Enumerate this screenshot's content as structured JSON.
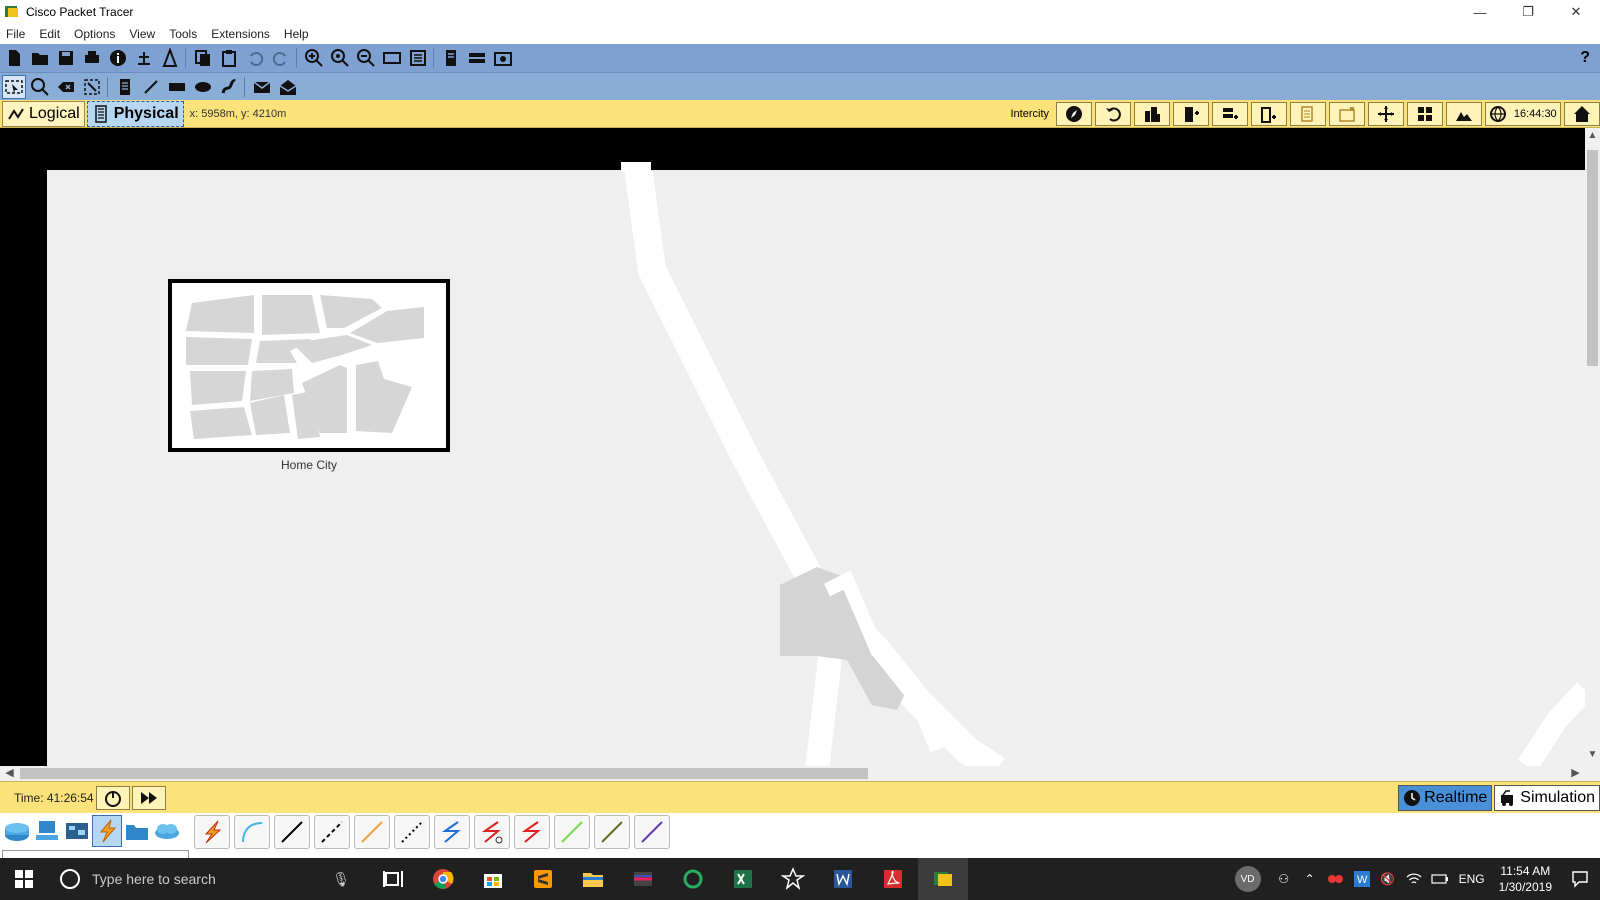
{
  "window": {
    "title": "Cisco Packet Tracer",
    "controls": {
      "minimize": "—",
      "restore": "❐",
      "close": "✕"
    }
  },
  "menu": [
    "File",
    "Edit",
    "Options",
    "View",
    "Tools",
    "Extensions",
    "Help"
  ],
  "toolbar": {
    "help": "?"
  },
  "nav": {
    "logical": "Logical",
    "physical": "Physical",
    "coords": "x: 5958m, y: 4210m",
    "location": "Intercity",
    "clock": "16:44:30"
  },
  "map": {
    "city_label": "Home City"
  },
  "timebar": {
    "time": "Time: 41:26:54",
    "realtime": "Realtime",
    "simulation": "Simulation"
  },
  "cables": [
    {
      "name": "automatic",
      "color": "#f0a020"
    },
    {
      "name": "console",
      "color": "#3fb8e0"
    },
    {
      "name": "copper-straight",
      "color": "#000000"
    },
    {
      "name": "copper-cross",
      "color": "#000000"
    },
    {
      "name": "fiber",
      "color": "#f0a040"
    },
    {
      "name": "phone",
      "color": "#000000"
    },
    {
      "name": "coaxial",
      "color": "#1e6fd9"
    },
    {
      "name": "serial-dce",
      "color": "#e02020"
    },
    {
      "name": "serial-dte",
      "color": "#e02020"
    },
    {
      "name": "octal",
      "color": "#70e050"
    },
    {
      "name": "iot",
      "color": "#607020"
    },
    {
      "name": "usb",
      "color": "#6040b0"
    }
  ],
  "taskbar": {
    "search_placeholder": "Type here to search",
    "avatar": "VD",
    "lang": "ENG",
    "time": "11:54 AM",
    "date": "1/30/2019"
  }
}
